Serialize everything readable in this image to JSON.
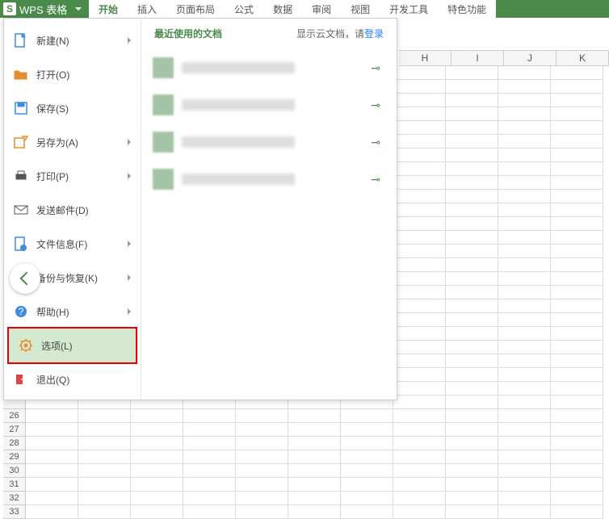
{
  "title_bar": {
    "app_name": "WPS 表格"
  },
  "ribbon": {
    "tabs": [
      "开始",
      "插入",
      "页面布局",
      "公式",
      "数据",
      "审阅",
      "视图",
      "开发工具",
      "特色功能"
    ],
    "active_index": 0
  },
  "file_menu": {
    "items": [
      {
        "label": "新建(N)",
        "has_sub": true,
        "icon": "new"
      },
      {
        "label": "打开(O)",
        "has_sub": false,
        "icon": "open"
      },
      {
        "label": "保存(S)",
        "has_sub": false,
        "icon": "save"
      },
      {
        "label": "另存为(A)",
        "has_sub": true,
        "icon": "saveas"
      },
      {
        "label": "打印(P)",
        "has_sub": true,
        "icon": "print"
      },
      {
        "label": "发送邮件(D)",
        "has_sub": false,
        "icon": "send"
      },
      {
        "label": "文件信息(F)",
        "has_sub": true,
        "icon": "info"
      },
      {
        "label": "备份与恢复(K)",
        "has_sub": true,
        "icon": "backup"
      },
      {
        "label": "帮助(H)",
        "has_sub": true,
        "icon": "help"
      },
      {
        "label": "选项(L)",
        "has_sub": false,
        "icon": "options",
        "highlighted": true
      },
      {
        "label": "退出(Q)",
        "has_sub": false,
        "icon": "exit"
      }
    ]
  },
  "recent": {
    "title": "最近使用的文档",
    "cloud_text_a": "显示云文档，请",
    "cloud_text_link": "登录",
    "items": [
      {
        "name": "doc1"
      },
      {
        "name": "doc2"
      },
      {
        "name": "doc3"
      },
      {
        "name": "doc4"
      }
    ]
  },
  "sheet": {
    "visible_cols": [
      "H",
      "I",
      "J",
      "K"
    ],
    "visible_rows_bottom": [
      26,
      27,
      28,
      29,
      30,
      31,
      32,
      33
    ]
  }
}
